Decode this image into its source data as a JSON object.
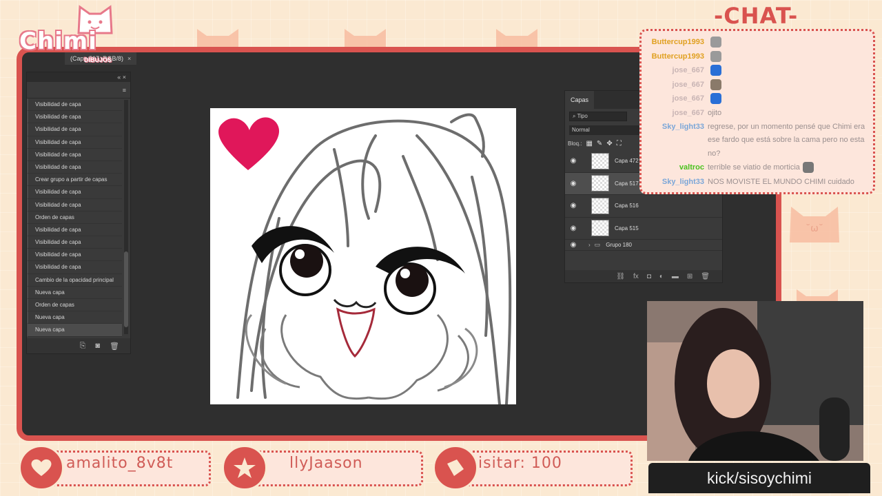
{
  "branding": {
    "logo_text": "Chimi",
    "logo_subtitle": "DIBUJOS"
  },
  "photoshop": {
    "document_tab": "(Capa 517, RGB/8)",
    "history_panel": {
      "items": [
        "Visibilidad de capa",
        "Visibilidad de capa",
        "Visibilidad de capa",
        "Visibilidad de capa",
        "Visibilidad de capa",
        "Visibilidad de capa",
        "Crear grupo a partir de capas",
        "Visibilidad de capa",
        "Visibilidad de capa",
        "Orden de capas",
        "Visibilidad de capa",
        "Visibilidad de capa",
        "Visibilidad de capa",
        "Visibilidad de capa",
        "Cambio de la opacidad principal",
        "Nueva capa",
        "Orden de capas",
        "Nueva capa",
        "Nueva capa"
      ],
      "active_index": 18
    },
    "layers_panel": {
      "tab": "Capas",
      "kind_filter": "Tipo",
      "blend_mode": "Normal",
      "lock_label": "Bloq.:",
      "layers": [
        {
          "name": "Capa 472",
          "selected": false
        },
        {
          "name": "Capa 517",
          "selected": true
        },
        {
          "name": "Capa 516",
          "selected": false
        },
        {
          "name": "Capa 515",
          "selected": false
        }
      ],
      "group_name": "Grupo 180"
    }
  },
  "chat": {
    "title": "-CHAT-",
    "messages": [
      {
        "user": "Buttercup1993",
        "color": "#e0a020",
        "text": "",
        "emote": "#9a9a9a"
      },
      {
        "user": "Buttercup1993",
        "color": "#e0a020",
        "text": "",
        "emote": "#9a9a9a"
      },
      {
        "user": "jose_667",
        "color": "#c8b4b4",
        "text": "",
        "emote": "#2a6fd6"
      },
      {
        "user": "jose_667",
        "color": "#c8b4b4",
        "text": "",
        "emote": "#8a7a6a"
      },
      {
        "user": "jose_667",
        "color": "#c8b4b4",
        "text": "",
        "emote": "#2a6fd6"
      },
      {
        "user": "jose_667",
        "color": "#c8b4b4",
        "text": "ojito",
        "emote": ""
      },
      {
        "user": "Sky_light33",
        "color": "#7aa6d8",
        "text": "regrese, por un momento pensé que Chimi era ese fardo que está sobre la cama pero no esta no?",
        "emote": ""
      },
      {
        "user": "valtroc",
        "color": "#49c21d",
        "text": "terrible se viatio de morticia",
        "emote": "#777777"
      },
      {
        "user": "Sky_light33",
        "color": "#7aa6d8",
        "text": "NOS MOVISTE EL MUNDO CHIMI cuidado",
        "emote": ""
      }
    ]
  },
  "webcam": {
    "label": "kick/sisoychimi"
  },
  "alerts": [
    {
      "icon": "heart-icon",
      "text": "amalito_8v8t"
    },
    {
      "icon": "star-icon",
      "text": "llyJaason"
    },
    {
      "icon": "tag-icon",
      "text": "isitar: 100"
    }
  ],
  "colors": {
    "accent": "#d9534f",
    "background": "#fbe9d2",
    "heart": "#e0175a"
  }
}
